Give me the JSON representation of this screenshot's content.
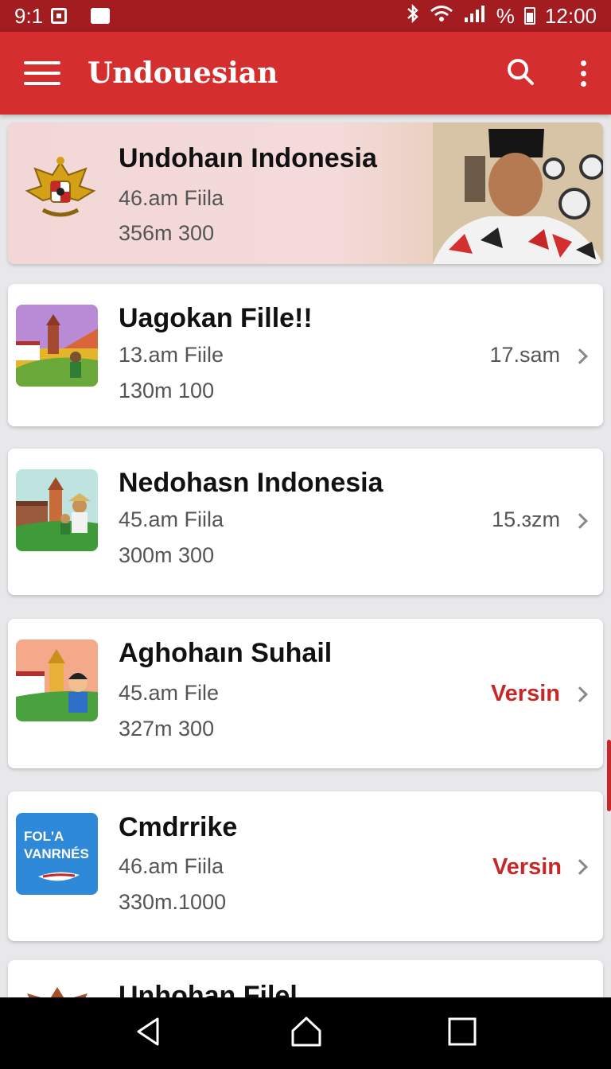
{
  "status_bar": {
    "time_left": "9:1",
    "battery_text": "%",
    "time_right": "12:00"
  },
  "app_bar": {
    "title": "Undouesian"
  },
  "featured": {
    "title": "Undohaın Indonesia",
    "line1": "46.am Fiila",
    "line2": "356m 300"
  },
  "items": [
    {
      "title": "Uagokan Fille!!",
      "line1": "13.am Fiile",
      "line2": "130m 100",
      "meta": "17.sam"
    },
    {
      "title": "Nedohasn Indonesia",
      "line1": "45.am Fiila",
      "line2": "300m 300",
      "meta": "15.ɜzm"
    },
    {
      "title": "Aghohaın Suhail",
      "line1": "45.am File",
      "line2": "327m 300",
      "meta": "Versin"
    },
    {
      "title": "Cmdrrike",
      "line1": "46.am Fiila",
      "line2": "330m.1000",
      "meta": "Versin",
      "thumb_text1": "FOL'A",
      "thumb_text2": "VANRNÉS"
    },
    {
      "title": "Unhohan Filel"
    }
  ],
  "colors": {
    "statusbar": "#a31c20",
    "appbar": "#d42e2e",
    "accent_red": "#c62828"
  }
}
